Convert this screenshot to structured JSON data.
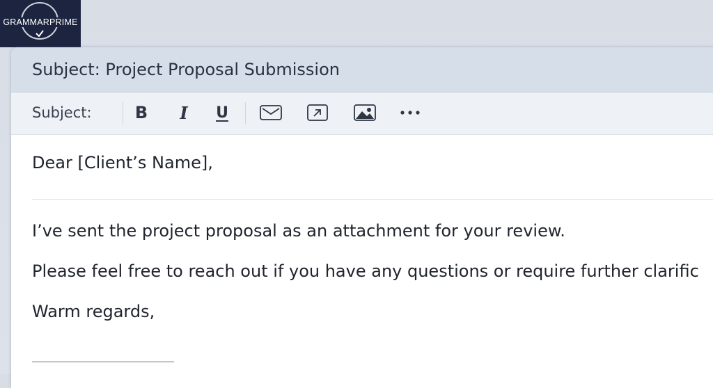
{
  "logo": {
    "text": "GRAMMARPRIME",
    "colors": {
      "background": "#1d2440",
      "text": "#ffffff"
    }
  },
  "email": {
    "title": "Subject: Project Proposal Submission",
    "toolbar": {
      "subject_label": "Subject:",
      "bold": "B",
      "italic": "I",
      "underline": "U",
      "icons": [
        "mail-icon",
        "link-icon",
        "image-icon",
        "more-icon"
      ]
    },
    "body": {
      "greeting": "Dear [Client’s Name],",
      "line1": "I’ve sent the project proposal as an attachment for your review.",
      "line2": "Please feel free to reach out if you have any questions or require further clarific",
      "closing": "Warm regards,"
    }
  },
  "colors": {
    "titlebar": "#d5dee9",
    "toolbar": "#eef1f6",
    "text": "#20242c"
  }
}
